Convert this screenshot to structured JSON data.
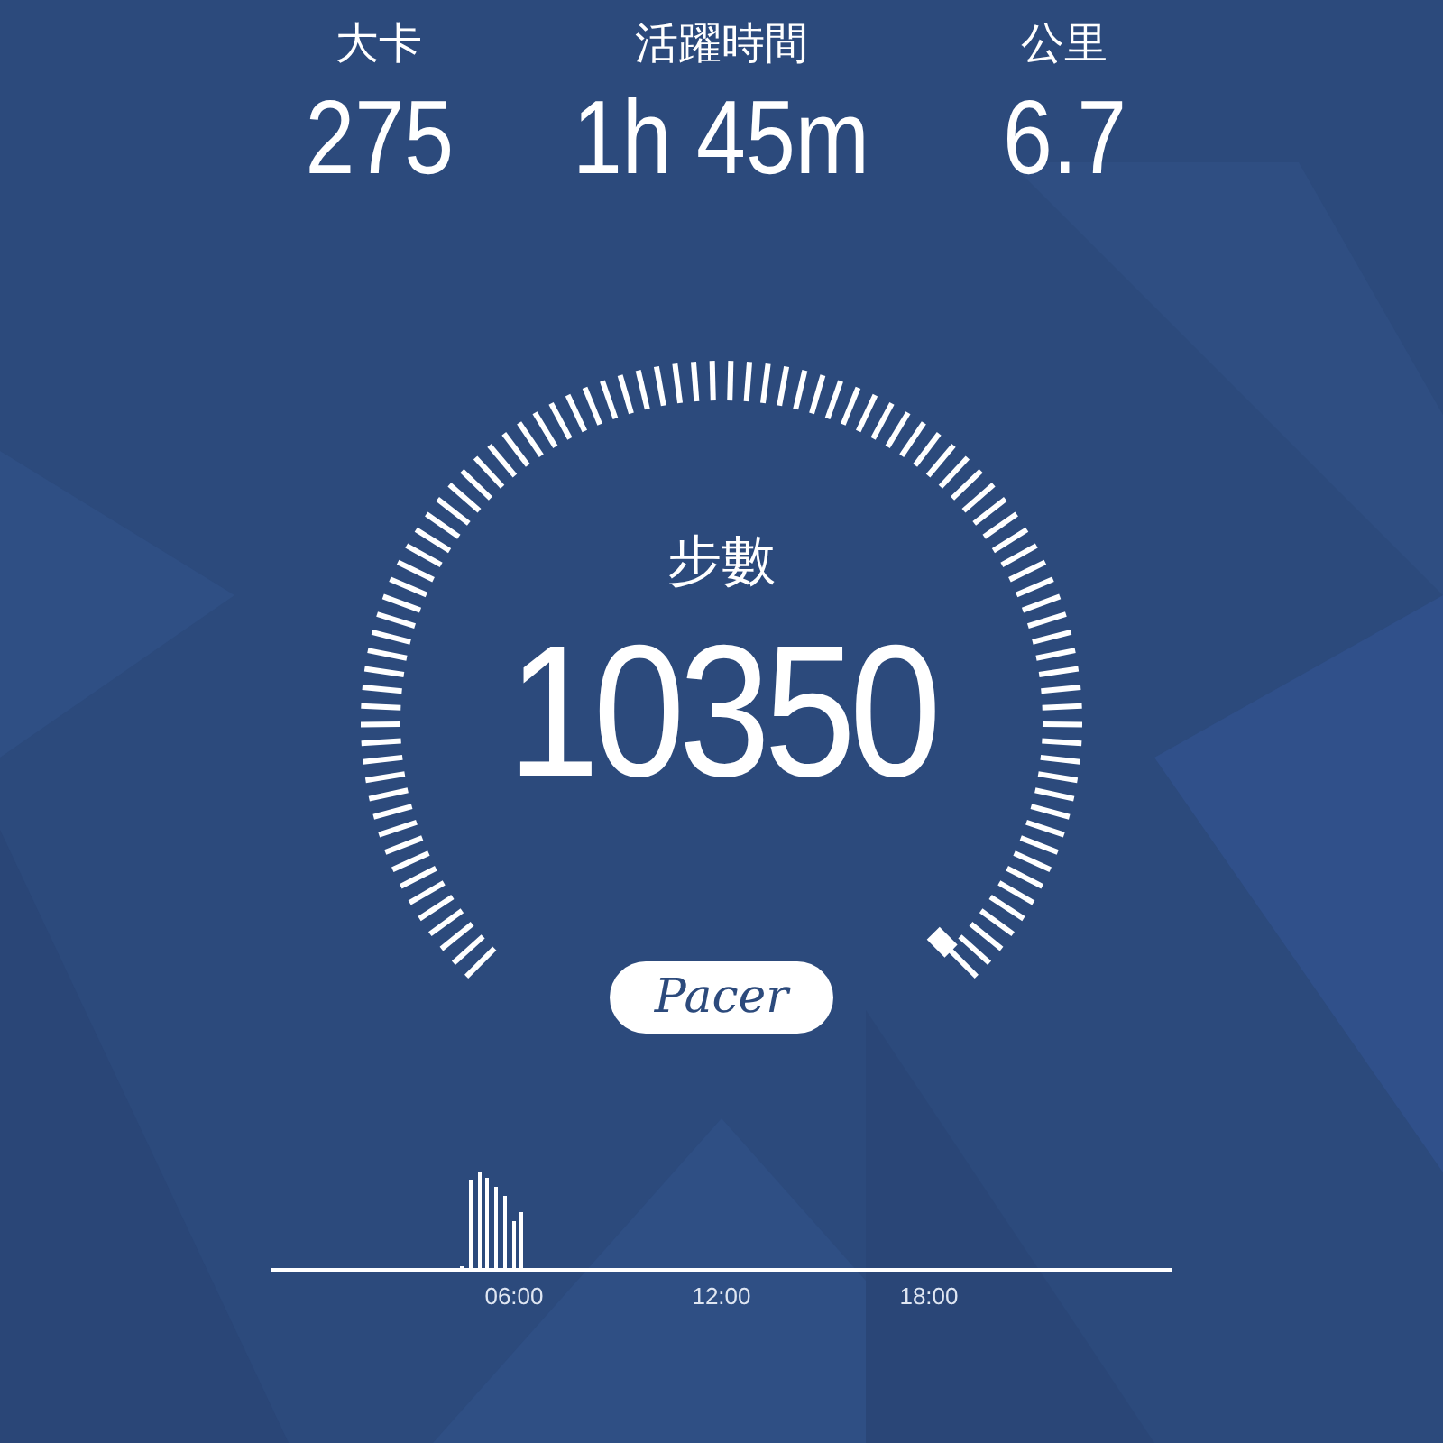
{
  "stats": [
    {
      "label": "大卡",
      "value": "275"
    },
    {
      "label": "活躍時間",
      "value": "1h 45m"
    },
    {
      "label": "公里",
      "value": "6.7"
    }
  ],
  "gauge": {
    "label": "步數",
    "value": "10350"
  },
  "logo": {
    "text": "Pacer"
  },
  "timeline": {
    "axis_labels": [
      "06:00",
      "12:00",
      "18:00"
    ]
  }
}
